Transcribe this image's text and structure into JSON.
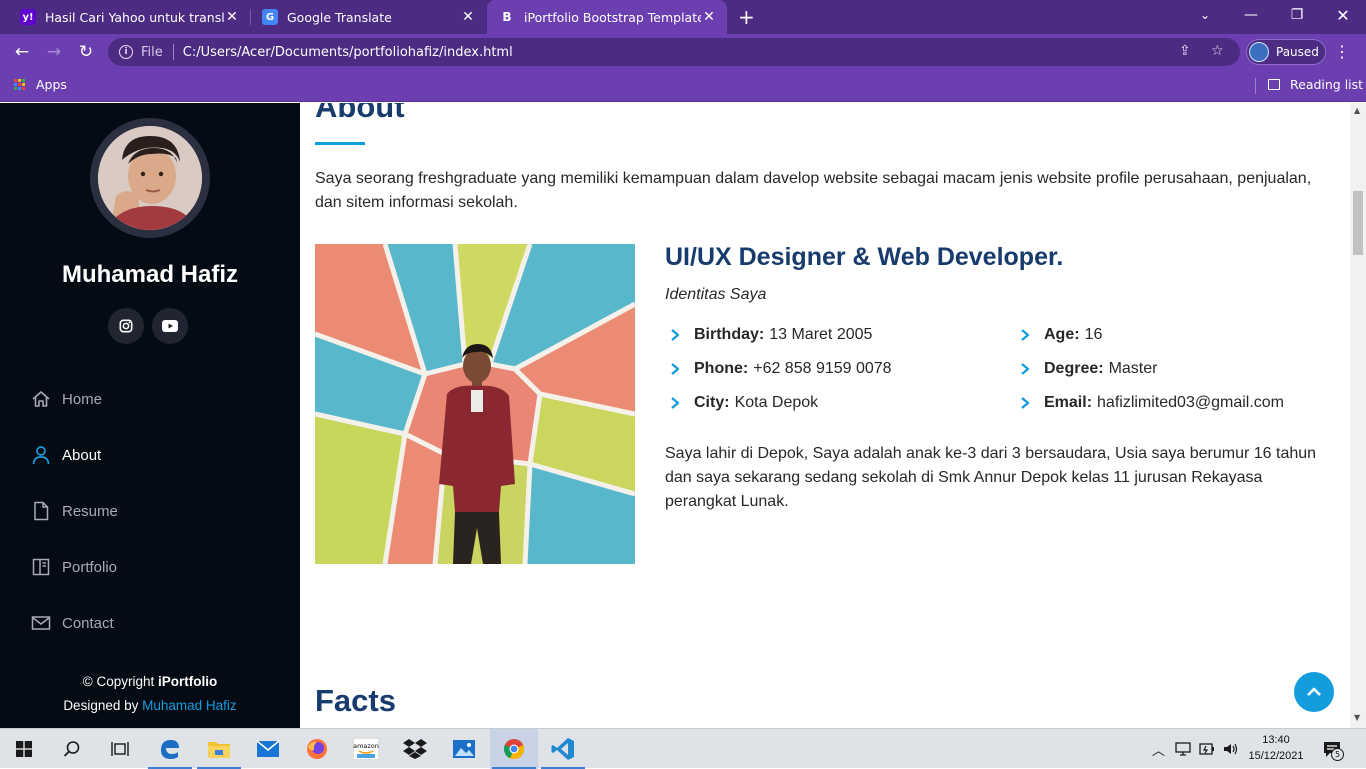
{
  "browser": {
    "tabs": [
      {
        "title": "Hasil Cari Yahoo untuk translate",
        "favicon": "yahoo-icon",
        "active": false
      },
      {
        "title": "Google Translate",
        "favicon": "google-translate-icon",
        "active": false
      },
      {
        "title": "iPortfolio Bootstrap Template - In",
        "favicon": "bootstrap-icon",
        "active": true
      }
    ],
    "address": {
      "scheme_label": "File",
      "url": "C:/Users/Acer/Documents/portfoliohafiz/index.html"
    },
    "profile_status": "Paused",
    "bookmarks": {
      "apps_label": "Apps",
      "reading_list_label": "Reading list"
    }
  },
  "sidebar": {
    "name": "Muhamad Hafiz",
    "social": [
      "instagram-icon",
      "youtube-icon"
    ],
    "nav": [
      {
        "label": "Home",
        "icon": "home-icon",
        "active": false
      },
      {
        "label": "About",
        "icon": "person-icon",
        "active": true
      },
      {
        "label": "Resume",
        "icon": "file-icon",
        "active": false
      },
      {
        "label": "Portfolio",
        "icon": "book-icon",
        "active": false
      },
      {
        "label": "Contact",
        "icon": "envelope-icon",
        "active": false
      }
    ],
    "footer": {
      "copyright_prefix": "© Copyright ",
      "brand": "iPortfolio",
      "designed_by_prefix": "Designed by ",
      "designer": "Muhamad Hafiz"
    }
  },
  "about": {
    "title": "About",
    "intro": "Saya seorang freshgraduate yang memiliki kemampuan dalam davelop website sebagai macam jenis website profile perusahaan, penjualan, dan sitem informasi sekolah.",
    "role": "UI/UX Designer & Web Developer.",
    "subtitle": "Identitas Saya",
    "details_left": [
      {
        "label": "Birthday:",
        "value": "13 Maret 2005"
      },
      {
        "label": "Phone:",
        "value": "+62 858 9159 0078"
      },
      {
        "label": "City:",
        "value": "Kota Depok"
      }
    ],
    "details_right": [
      {
        "label": "Age:",
        "value": "16"
      },
      {
        "label": "Degree:",
        "value": "Master"
      },
      {
        "label": "Email:",
        "value": "hafizlimited03@gmail.com"
      }
    ],
    "bio": "Saya lahir di Depok, Saya adalah anak ke-3 dari 3 bersaudara, Usia saya berumur 16 tahun dan saya sekarang sedang sekolah di Smk Annur Depok kelas 11 jurusan Rekayasa perangkat Lunak."
  },
  "facts": {
    "title": "Facts"
  },
  "taskbar": {
    "apps": [
      "windows-start-icon",
      "search-icon",
      "task-view-icon",
      "edge-icon",
      "file-explorer-icon",
      "mail-icon",
      "firefox-icon",
      "amazon-icon",
      "dropbox-icon",
      "photos-icon",
      "chrome-icon",
      "vscode-icon"
    ],
    "time": "13:40",
    "date": "15/12/2021",
    "notification_count": "5"
  },
  "colors": {
    "accent": "#149ddd",
    "heading": "#173b6c",
    "sidebar_bg": "#040b14",
    "browser_frame": "#6b3fb0"
  }
}
